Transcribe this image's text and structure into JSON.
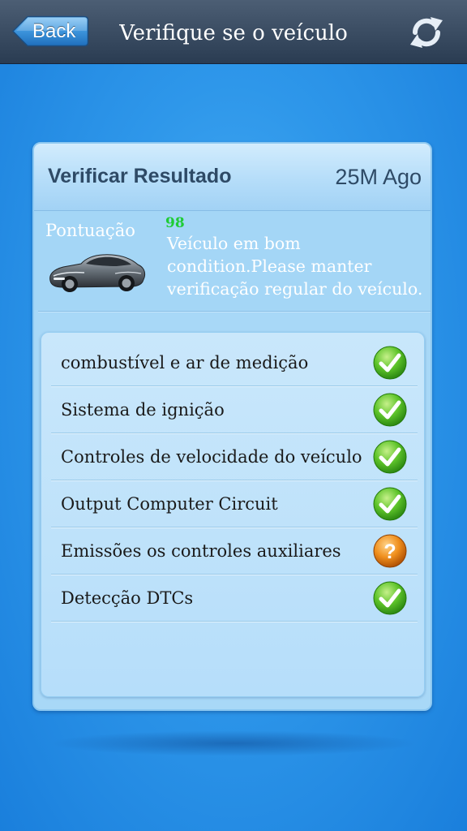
{
  "nav": {
    "back_label": "Back",
    "title": "Verifique se o veículo",
    "refresh_icon": "refresh-icon"
  },
  "result": {
    "title": "Verificar Resultado",
    "time": "25M Ago"
  },
  "score": {
    "label": "Pontuação",
    "value": "98",
    "message": "Veículo em bom condition.Please manter verificação regular do veículo."
  },
  "checks": [
    {
      "label": "combustível e ar de medição",
      "status": "ok",
      "icon": "check-icon"
    },
    {
      "label": "Sistema de ignição",
      "status": "ok",
      "icon": "check-icon"
    },
    {
      "label": "Controles de velocidade do veículo",
      "status": "ok",
      "icon": "check-icon"
    },
    {
      "label": "Output Computer Circuit",
      "status": "ok",
      "icon": "check-icon"
    },
    {
      "label": "Emissões os controles auxiliares",
      "status": "unknown",
      "icon": "question-icon"
    },
    {
      "label": "Detecção DTCs",
      "status": "ok",
      "icon": "check-icon"
    }
  ],
  "colors": {
    "background": "#2e97ea",
    "navbar": "#33465c",
    "score": "#1fcc35",
    "status_ok": "#43b81f",
    "status_unknown": "#e07b14"
  }
}
